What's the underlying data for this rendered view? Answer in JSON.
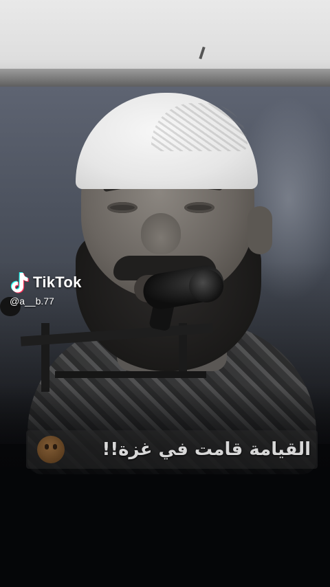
{
  "watermark": {
    "brand": "TikTok",
    "handle": "@a__b.77",
    "icon": "tiktok-note-icon"
  },
  "caption": {
    "text": "القيامة قامت في غزة!!",
    "emoji": "crying-face-icon"
  },
  "colors": {
    "background": "#050608",
    "caption_text": "#d8d8d8",
    "watermark_text": "#ffffff"
  }
}
